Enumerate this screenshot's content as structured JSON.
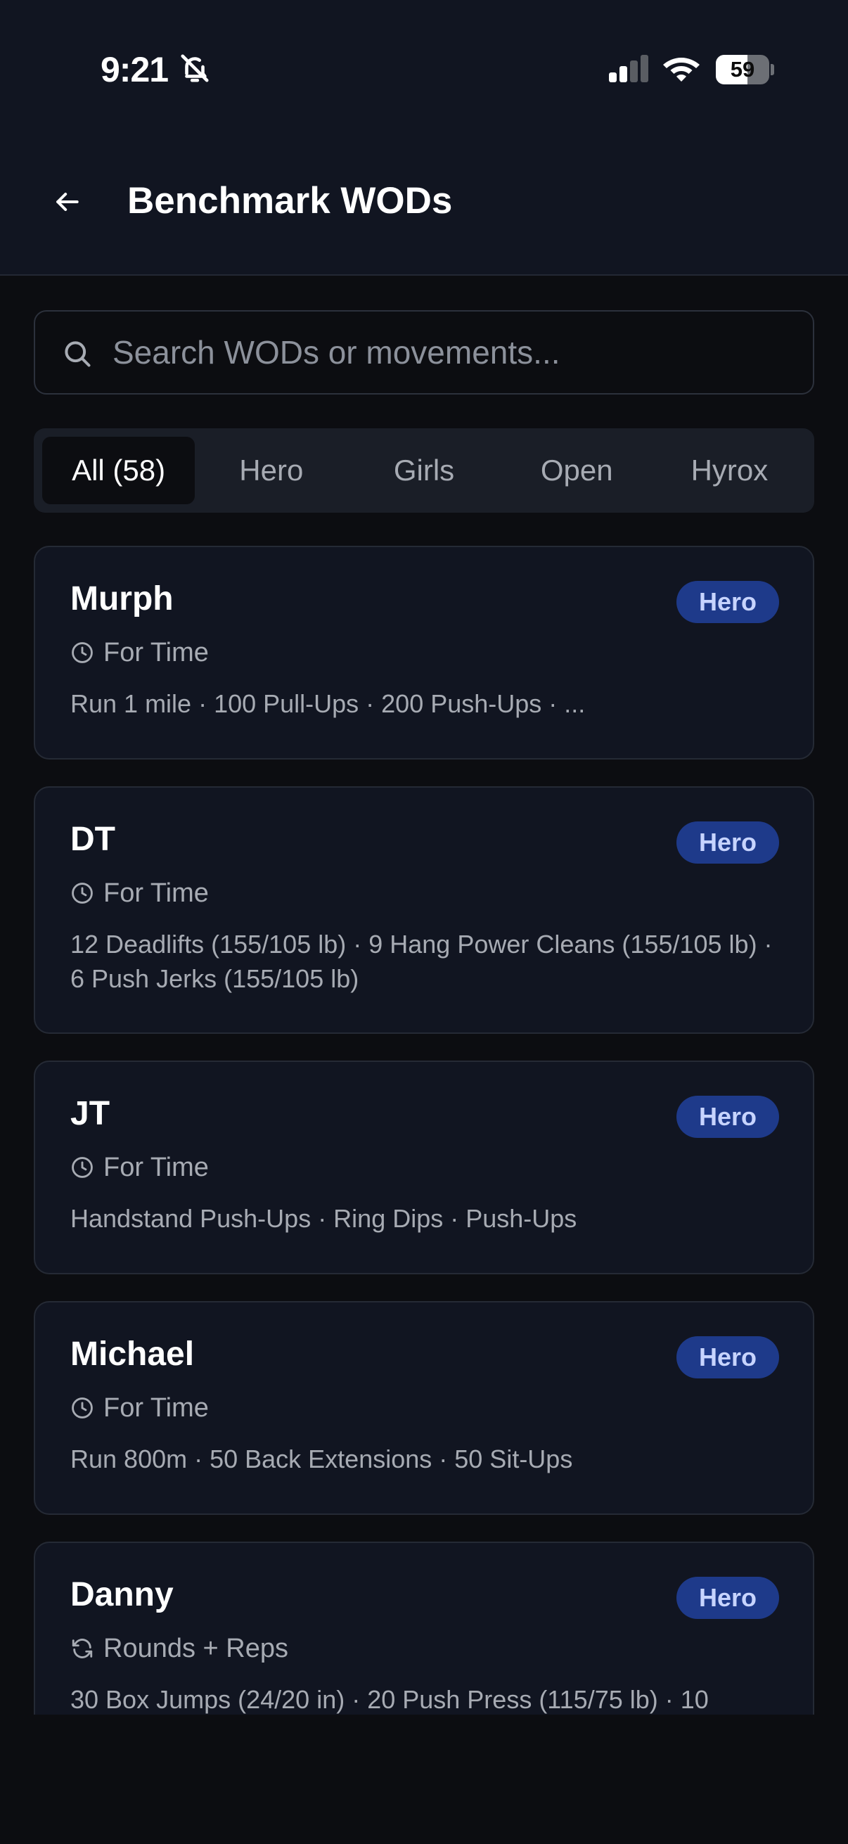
{
  "status_bar": {
    "time": "9:21",
    "battery_percent": "59",
    "battery_level": 0.59,
    "icons": [
      "bell-slash-icon",
      "cellular-signal-icon",
      "wifi-icon",
      "battery-icon"
    ]
  },
  "header": {
    "back_icon": "arrow-left-icon",
    "title": "Benchmark WODs"
  },
  "search": {
    "placeholder": "Search WODs or movements...",
    "value": "",
    "icon": "search-icon"
  },
  "tabs": [
    {
      "label": "All (58)",
      "active": true
    },
    {
      "label": "Hero",
      "active": false
    },
    {
      "label": "Girls",
      "active": false
    },
    {
      "label": "Open",
      "active": false
    },
    {
      "label": "Hyrox",
      "active": false
    }
  ],
  "wods": [
    {
      "name": "Murph",
      "badge": "Hero",
      "type": "For Time",
      "type_icon": "clock-icon",
      "movements": "Run 1 mile · 100 Pull-Ups · 200 Push-Ups · ..."
    },
    {
      "name": "DT",
      "badge": "Hero",
      "type": "For Time",
      "type_icon": "clock-icon",
      "movements": "12 Deadlifts (155/105 lb) · 9 Hang Power Cleans (155/105 lb) · 6 Push Jerks (155/105 lb)"
    },
    {
      "name": "JT",
      "badge": "Hero",
      "type": "For Time",
      "type_icon": "clock-icon",
      "movements": "Handstand Push-Ups · Ring Dips · Push-Ups"
    },
    {
      "name": "Michael",
      "badge": "Hero",
      "type": "For Time",
      "type_icon": "clock-icon",
      "movements": "Run 800m · 50 Back Extensions · 50 Sit-Ups"
    },
    {
      "name": "Danny",
      "badge": "Hero",
      "type": "Rounds + Reps",
      "type_icon": "refresh-icon",
      "movements": "30 Box Jumps (24/20 in) · 20 Push Press (115/75 lb) · 10"
    }
  ],
  "colors": {
    "background": "#0c0d11",
    "card": "#111521",
    "badge": "#1e3a8a",
    "badge_text": "#c7d4ff",
    "muted_text": "#a7abb3"
  }
}
